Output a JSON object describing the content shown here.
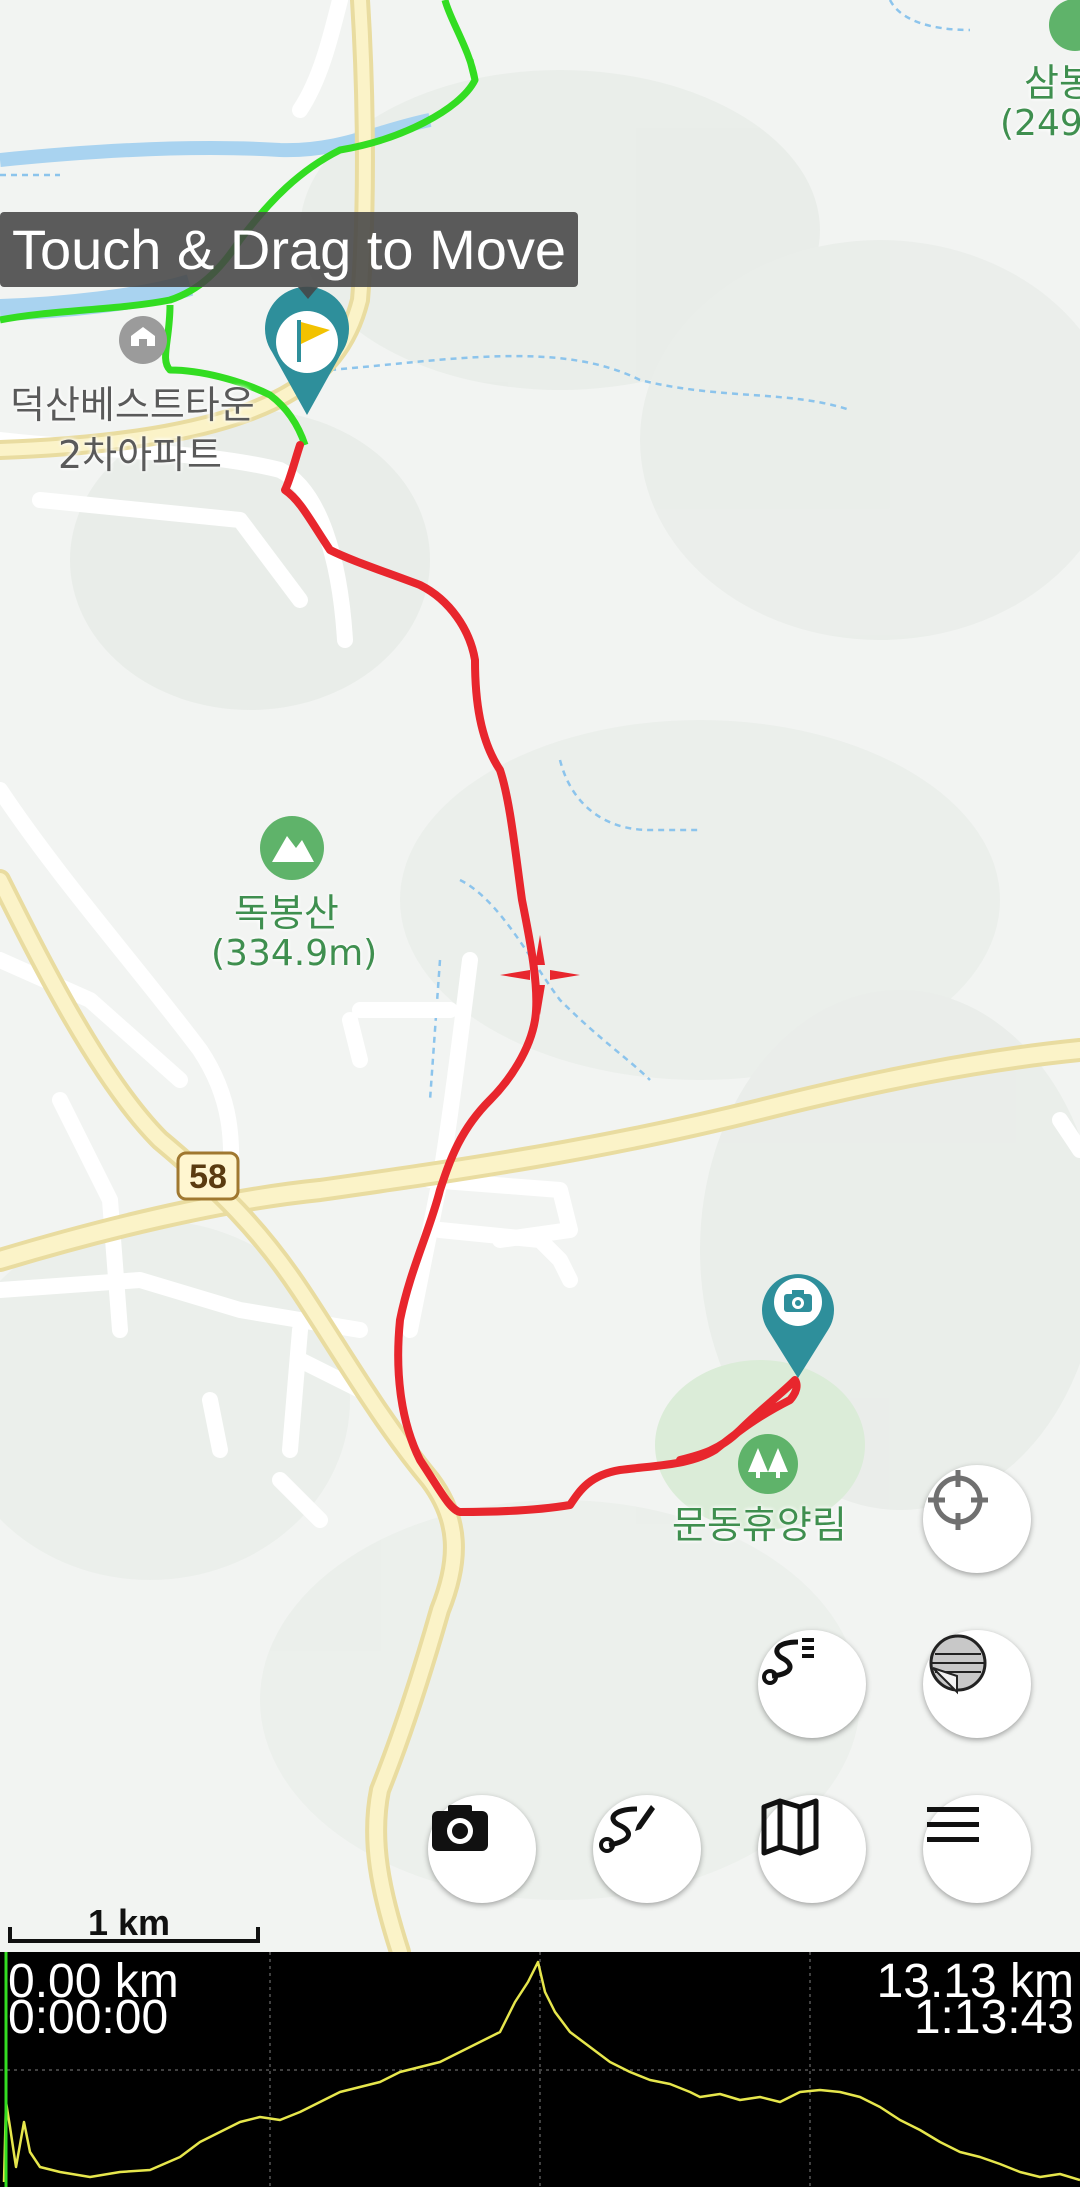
{
  "tooltip": {
    "text": "Touch & Drag to Move"
  },
  "map_labels": {
    "apartment": "덕산베스트타운\n2차아파트",
    "apartment_line1": "덕산베스트타운",
    "apartment_line2": "2차아파트",
    "mountain_name": "독봉산",
    "mountain_height": "(334.9m)",
    "forest": "문동휴양림",
    "corner_name": "삼봉",
    "corner_height": "(249",
    "road_number": "58"
  },
  "markers": {
    "start": {
      "icon": "flag-icon",
      "color": "#2e8f9b"
    },
    "photo": {
      "icon": "camera-icon",
      "color": "#2e8f9b"
    }
  },
  "colors": {
    "track": "#e8262d",
    "other_track": "#33dd22",
    "marker": "#2e8f9b",
    "profile_line": "#e6e64c"
  },
  "buttons": {
    "locate": "crosshair-icon",
    "track_list": "track-list-icon",
    "layer": "layer-icon",
    "camera": "camera-icon",
    "route_edit": "route-edit-icon",
    "map": "map-icon",
    "menu": "menu-icon"
  },
  "scale_bar": {
    "label": "1 km"
  },
  "profile": {
    "start_distance": "0.00 km",
    "start_time": "0:00:00",
    "end_distance": "13.13 km",
    "end_time": "1:13:43"
  }
}
